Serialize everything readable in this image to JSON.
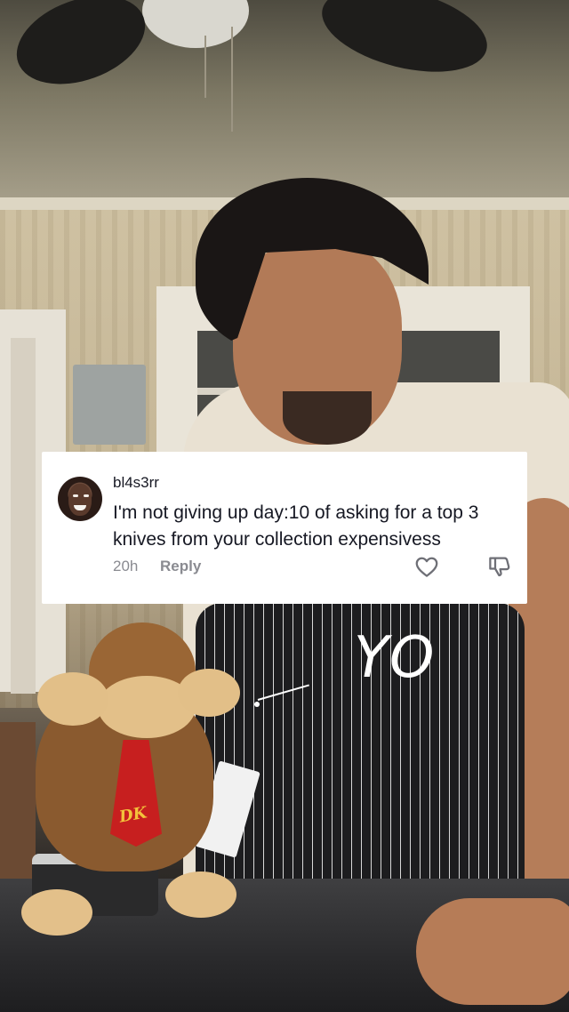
{
  "comment": {
    "username": "bl4s3rr",
    "text": "I'm not giving up day:10 of asking for a top 3 knives from your collection expensivess",
    "time": "20h",
    "reply_label": "Reply",
    "like_icon": "heart-outline-icon",
    "dislike_icon": "thumbs-down-outline-icon"
  },
  "overlay": {
    "caption": "YO",
    "toy_tie_text": "DK"
  }
}
